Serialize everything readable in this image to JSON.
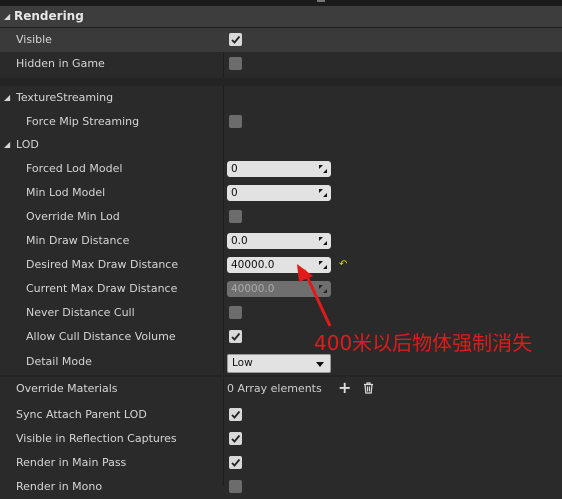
{
  "section": {
    "title": "Rendering"
  },
  "visible": {
    "label": "Visible",
    "checked": true
  },
  "hidden_in_game": {
    "label": "Hidden in Game",
    "checked": false
  },
  "texture_streaming": {
    "label": "TextureStreaming"
  },
  "force_mip_streaming": {
    "label": "Force Mip Streaming",
    "checked": false
  },
  "lod": {
    "label": "LOD"
  },
  "forced_lod_model": {
    "label": "Forced Lod Model",
    "value": "0"
  },
  "min_lod_model": {
    "label": "Min Lod Model",
    "value": "0"
  },
  "override_min_lod": {
    "label": "Override Min Lod",
    "checked": false
  },
  "min_draw_distance": {
    "label": "Min Draw Distance",
    "value": "0.0"
  },
  "desired_max_draw_distance": {
    "label": "Desired Max Draw Distance",
    "value": "40000.0"
  },
  "current_max_draw_distance": {
    "label": "Current Max Draw Distance",
    "value": "40000.0"
  },
  "never_distance_cull": {
    "label": "Never Distance Cull",
    "checked": false
  },
  "allow_cull_distance_volume": {
    "label": "Allow Cull Distance Volume",
    "checked": true
  },
  "detail_mode": {
    "label": "Detail Mode",
    "value": "Low"
  },
  "override_materials": {
    "label": "Override Materials",
    "value": "0 Array elements"
  },
  "sync_attach_parent_lod": {
    "label": "Sync Attach Parent LOD",
    "checked": true
  },
  "visible_in_reflection_captures": {
    "label": "Visible in Reflection Captures",
    "checked": true
  },
  "render_in_main_pass": {
    "label": "Render in Main Pass",
    "checked": true
  },
  "render_in_mono": {
    "label": "Render in Mono",
    "checked": false
  },
  "annotation": {
    "text": "400米以后物体强制消失",
    "color": "#e11a1a"
  },
  "icons": {
    "reset": "reset-arrow-icon",
    "add": "plus-icon",
    "delete": "trash-icon"
  }
}
